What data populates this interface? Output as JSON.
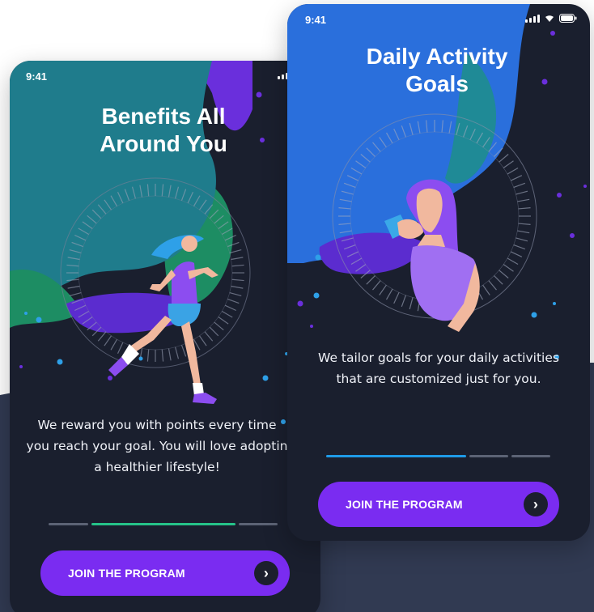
{
  "screens": [
    {
      "status_time": "9:41",
      "title_line1": "Benefits All",
      "title_line2": "Around You",
      "description_line1": "We reward you with points every time",
      "description_line2": "you reach your goal. You will love adoptin",
      "description_line3": "a healthier lifestyle!",
      "progress_steps": 3,
      "active_step": 2,
      "cta_label": "JOIN THE PROGRAM",
      "cta_icon": "chevron-right-icon"
    },
    {
      "status_time": "9:41",
      "title_line1": "Daily Activity",
      "title_line2": "Goals",
      "description_line1": "We tailor goals for your daily activities",
      "description_line2": "that are customized just for you.",
      "progress_steps": 3,
      "active_step": 1,
      "cta_label": "JOIN THE PROGRAM",
      "cta_icon": "chevron-right-icon"
    }
  ],
  "colors": {
    "phone_bg": "#1a1f2e",
    "backdrop": "#313a52",
    "accent_purple": "#7a2cf1",
    "progress_active_left": "#25c389",
    "progress_active_right": "#1f9be8",
    "progress_inactive": "#5c6375",
    "blob_teal": "#1f8a96",
    "blob_blue": "#2a6fdc",
    "blob_green": "#1d8d63"
  }
}
